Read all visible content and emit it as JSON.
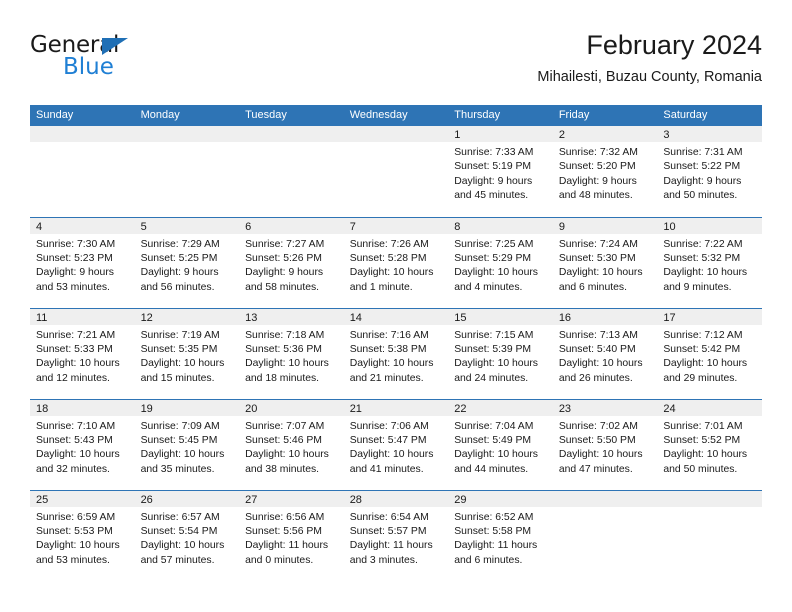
{
  "logo": {
    "word_one": "General",
    "word_two": "Blue",
    "triangle_color": "#1f6fb5",
    "blue_color": "#1f7fd4"
  },
  "header": {
    "title": "February 2024",
    "subtitle": "Mihailesti, Buzau County, Romania"
  },
  "theme": {
    "header_blue": "#2e74b5",
    "daynum_gray": "#efefef",
    "text": "#1a1a1a"
  },
  "calendar": {
    "weekday_headers": [
      "Sunday",
      "Monday",
      "Tuesday",
      "Wednesday",
      "Thursday",
      "Friday",
      "Saturday"
    ],
    "weeks": [
      [
        {
          "day": "",
          "lines": []
        },
        {
          "day": "",
          "lines": []
        },
        {
          "day": "",
          "lines": []
        },
        {
          "day": "",
          "lines": []
        },
        {
          "day": "1",
          "lines": [
            "Sunrise: 7:33 AM",
            "Sunset: 5:19 PM",
            "Daylight: 9 hours",
            "and 45 minutes."
          ]
        },
        {
          "day": "2",
          "lines": [
            "Sunrise: 7:32 AM",
            "Sunset: 5:20 PM",
            "Daylight: 9 hours",
            "and 48 minutes."
          ]
        },
        {
          "day": "3",
          "lines": [
            "Sunrise: 7:31 AM",
            "Sunset: 5:22 PM",
            "Daylight: 9 hours",
            "and 50 minutes."
          ]
        }
      ],
      [
        {
          "day": "4",
          "lines": [
            "Sunrise: 7:30 AM",
            "Sunset: 5:23 PM",
            "Daylight: 9 hours",
            "and 53 minutes."
          ]
        },
        {
          "day": "5",
          "lines": [
            "Sunrise: 7:29 AM",
            "Sunset: 5:25 PM",
            "Daylight: 9 hours",
            "and 56 minutes."
          ]
        },
        {
          "day": "6",
          "lines": [
            "Sunrise: 7:27 AM",
            "Sunset: 5:26 PM",
            "Daylight: 9 hours",
            "and 58 minutes."
          ]
        },
        {
          "day": "7",
          "lines": [
            "Sunrise: 7:26 AM",
            "Sunset: 5:28 PM",
            "Daylight: 10 hours",
            "and 1 minute."
          ]
        },
        {
          "day": "8",
          "lines": [
            "Sunrise: 7:25 AM",
            "Sunset: 5:29 PM",
            "Daylight: 10 hours",
            "and 4 minutes."
          ]
        },
        {
          "day": "9",
          "lines": [
            "Sunrise: 7:24 AM",
            "Sunset: 5:30 PM",
            "Daylight: 10 hours",
            "and 6 minutes."
          ]
        },
        {
          "day": "10",
          "lines": [
            "Sunrise: 7:22 AM",
            "Sunset: 5:32 PM",
            "Daylight: 10 hours",
            "and 9 minutes."
          ]
        }
      ],
      [
        {
          "day": "11",
          "lines": [
            "Sunrise: 7:21 AM",
            "Sunset: 5:33 PM",
            "Daylight: 10 hours",
            "and 12 minutes."
          ]
        },
        {
          "day": "12",
          "lines": [
            "Sunrise: 7:19 AM",
            "Sunset: 5:35 PM",
            "Daylight: 10 hours",
            "and 15 minutes."
          ]
        },
        {
          "day": "13",
          "lines": [
            "Sunrise: 7:18 AM",
            "Sunset: 5:36 PM",
            "Daylight: 10 hours",
            "and 18 minutes."
          ]
        },
        {
          "day": "14",
          "lines": [
            "Sunrise: 7:16 AM",
            "Sunset: 5:38 PM",
            "Daylight: 10 hours",
            "and 21 minutes."
          ]
        },
        {
          "day": "15",
          "lines": [
            "Sunrise: 7:15 AM",
            "Sunset: 5:39 PM",
            "Daylight: 10 hours",
            "and 24 minutes."
          ]
        },
        {
          "day": "16",
          "lines": [
            "Sunrise: 7:13 AM",
            "Sunset: 5:40 PM",
            "Daylight: 10 hours",
            "and 26 minutes."
          ]
        },
        {
          "day": "17",
          "lines": [
            "Sunrise: 7:12 AM",
            "Sunset: 5:42 PM",
            "Daylight: 10 hours",
            "and 29 minutes."
          ]
        }
      ],
      [
        {
          "day": "18",
          "lines": [
            "Sunrise: 7:10 AM",
            "Sunset: 5:43 PM",
            "Daylight: 10 hours",
            "and 32 minutes."
          ]
        },
        {
          "day": "19",
          "lines": [
            "Sunrise: 7:09 AM",
            "Sunset: 5:45 PM",
            "Daylight: 10 hours",
            "and 35 minutes."
          ]
        },
        {
          "day": "20",
          "lines": [
            "Sunrise: 7:07 AM",
            "Sunset: 5:46 PM",
            "Daylight: 10 hours",
            "and 38 minutes."
          ]
        },
        {
          "day": "21",
          "lines": [
            "Sunrise: 7:06 AM",
            "Sunset: 5:47 PM",
            "Daylight: 10 hours",
            "and 41 minutes."
          ]
        },
        {
          "day": "22",
          "lines": [
            "Sunrise: 7:04 AM",
            "Sunset: 5:49 PM",
            "Daylight: 10 hours",
            "and 44 minutes."
          ]
        },
        {
          "day": "23",
          "lines": [
            "Sunrise: 7:02 AM",
            "Sunset: 5:50 PM",
            "Daylight: 10 hours",
            "and 47 minutes."
          ]
        },
        {
          "day": "24",
          "lines": [
            "Sunrise: 7:01 AM",
            "Sunset: 5:52 PM",
            "Daylight: 10 hours",
            "and 50 minutes."
          ]
        }
      ],
      [
        {
          "day": "25",
          "lines": [
            "Sunrise: 6:59 AM",
            "Sunset: 5:53 PM",
            "Daylight: 10 hours",
            "and 53 minutes."
          ]
        },
        {
          "day": "26",
          "lines": [
            "Sunrise: 6:57 AM",
            "Sunset: 5:54 PM",
            "Daylight: 10 hours",
            "and 57 minutes."
          ]
        },
        {
          "day": "27",
          "lines": [
            "Sunrise: 6:56 AM",
            "Sunset: 5:56 PM",
            "Daylight: 11 hours",
            "and 0 minutes."
          ]
        },
        {
          "day": "28",
          "lines": [
            "Sunrise: 6:54 AM",
            "Sunset: 5:57 PM",
            "Daylight: 11 hours",
            "and 3 minutes."
          ]
        },
        {
          "day": "29",
          "lines": [
            "Sunrise: 6:52 AM",
            "Sunset: 5:58 PM",
            "Daylight: 11 hours",
            "and 6 minutes."
          ]
        },
        {
          "day": "",
          "lines": []
        },
        {
          "day": "",
          "lines": []
        }
      ]
    ]
  }
}
